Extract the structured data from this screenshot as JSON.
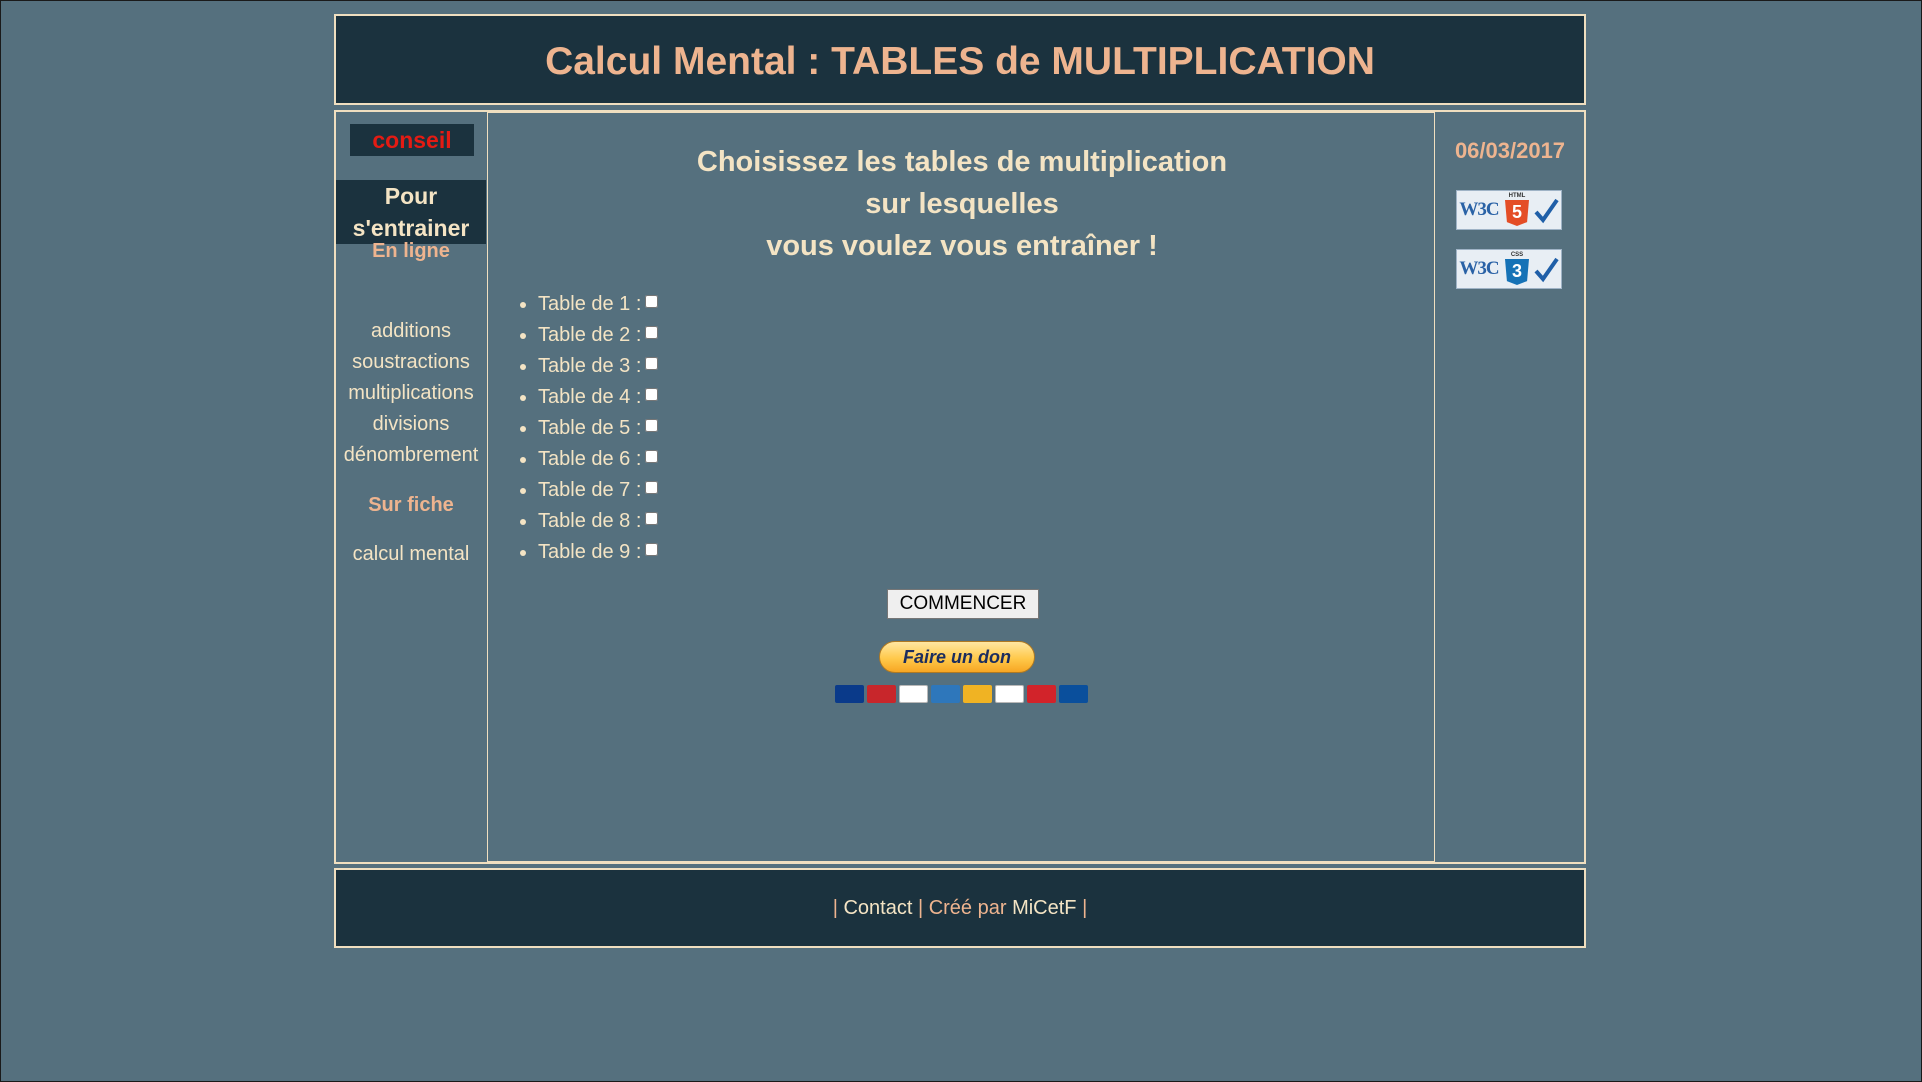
{
  "header": {
    "title": "Calcul Mental : TABLES de MULTIPLICATION"
  },
  "sidebar": {
    "conseil_label": "conseil",
    "train_line1": "Pour",
    "train_line2": "s'entrainer",
    "online_heading": "En ligne",
    "online_links": [
      "additions",
      "soustractions",
      "multiplications",
      "divisions",
      "dénombrement"
    ],
    "sheet_heading": "Sur fiche",
    "sheet_links": [
      "calcul mental"
    ]
  },
  "main": {
    "title_lines": [
      "Choisissez les tables de multiplication",
      "sur lesquelles",
      "vous voulez vous entraîner !"
    ],
    "tables": [
      {
        "label": "Table de 1 :",
        "checked": false
      },
      {
        "label": "Table de 2 :",
        "checked": false
      },
      {
        "label": "Table de 3 :",
        "checked": false
      },
      {
        "label": "Table de 4 :",
        "checked": false
      },
      {
        "label": "Table de 5 :",
        "checked": false
      },
      {
        "label": "Table de 6 :",
        "checked": false
      },
      {
        "label": "Table de 7 :",
        "checked": false
      },
      {
        "label": "Table de 8 :",
        "checked": false
      },
      {
        "label": "Table de 9 :",
        "checked": false
      }
    ],
    "start_button": "COMMENCER",
    "donate_button": "Faire un don",
    "payment_cards": [
      {
        "name": "maestro-card",
        "color": "#0a3a8a"
      },
      {
        "name": "mastercard-card",
        "color": "#c8262b"
      },
      {
        "name": "visa-card",
        "color": "#ffffff"
      },
      {
        "name": "amex-card",
        "color": "#2e77bb"
      },
      {
        "name": "aurore-card",
        "color": "#f0b323"
      },
      {
        "name": "cofinoga-card",
        "color": "#ffffff"
      },
      {
        "name": "4etoiles-card",
        "color": "#d2232a"
      },
      {
        "name": "cb-card",
        "color": "#0a4f9c"
      }
    ]
  },
  "right": {
    "date": "06/03/2017",
    "badges": [
      {
        "w3c": "W3C",
        "label": "HTML",
        "number": "5",
        "color": "#e44d26"
      },
      {
        "w3c": "W3C",
        "label": "CSS",
        "number": "3",
        "color": "#1572b6"
      }
    ]
  },
  "footer": {
    "sep1": "| ",
    "contact": "Contact",
    "sep2": " | Créé par ",
    "author": "MiCetF",
    "sep3": " |"
  },
  "colors": {
    "background": "#55707e",
    "panel_dark": "#1b323e",
    "accent_salmon": "#eeb48f",
    "text_cream": "#f4e4c4",
    "alert_red": "#e41b13"
  }
}
